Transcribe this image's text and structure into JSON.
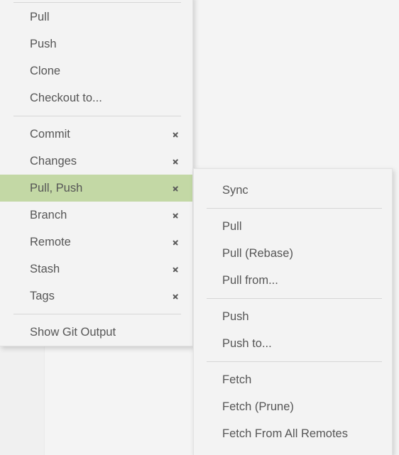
{
  "app": {
    "background_color": "#f4f4f4",
    "rail_color": "#f0f0f0"
  },
  "context_menu": {
    "name": "git-context-menu",
    "highlight_color": "#c3d8a5",
    "text_color": "#565656",
    "surface_color": "#f3f3f3",
    "groups": [
      {
        "items": [
          {
            "label": "Pull",
            "submenu": false,
            "highlighted": false
          },
          {
            "label": "Push",
            "submenu": false,
            "highlighted": false
          },
          {
            "label": "Clone",
            "submenu": false,
            "highlighted": false
          },
          {
            "label": "Checkout to...",
            "submenu": false,
            "highlighted": false
          }
        ]
      },
      {
        "items": [
          {
            "label": "Commit",
            "submenu": true,
            "highlighted": false
          },
          {
            "label": "Changes",
            "submenu": true,
            "highlighted": false
          },
          {
            "label": "Pull, Push",
            "submenu": true,
            "highlighted": true
          },
          {
            "label": "Branch",
            "submenu": true,
            "highlighted": false
          },
          {
            "label": "Remote",
            "submenu": true,
            "highlighted": false
          },
          {
            "label": "Stash",
            "submenu": true,
            "highlighted": false
          },
          {
            "label": "Tags",
            "submenu": true,
            "highlighted": false
          }
        ]
      },
      {
        "items": [
          {
            "label": "Show Git Output",
            "submenu": false,
            "highlighted": false
          }
        ]
      }
    ]
  },
  "submenu": {
    "name": "pull-push-submenu",
    "parent_item": "Pull, Push",
    "groups": [
      {
        "items": [
          {
            "label": "Sync",
            "submenu": false,
            "highlighted": false
          }
        ]
      },
      {
        "items": [
          {
            "label": "Pull",
            "submenu": false,
            "highlighted": false
          },
          {
            "label": "Pull (Rebase)",
            "submenu": false,
            "highlighted": false
          },
          {
            "label": "Pull from...",
            "submenu": false,
            "highlighted": false
          }
        ]
      },
      {
        "items": [
          {
            "label": "Push",
            "submenu": false,
            "highlighted": false
          },
          {
            "label": "Push to...",
            "submenu": false,
            "highlighted": false
          }
        ]
      },
      {
        "items": [
          {
            "label": "Fetch",
            "submenu": false,
            "highlighted": false
          },
          {
            "label": "Fetch (Prune)",
            "submenu": false,
            "highlighted": false
          },
          {
            "label": "Fetch From All Remotes",
            "submenu": false,
            "highlighted": false
          }
        ]
      }
    ]
  }
}
